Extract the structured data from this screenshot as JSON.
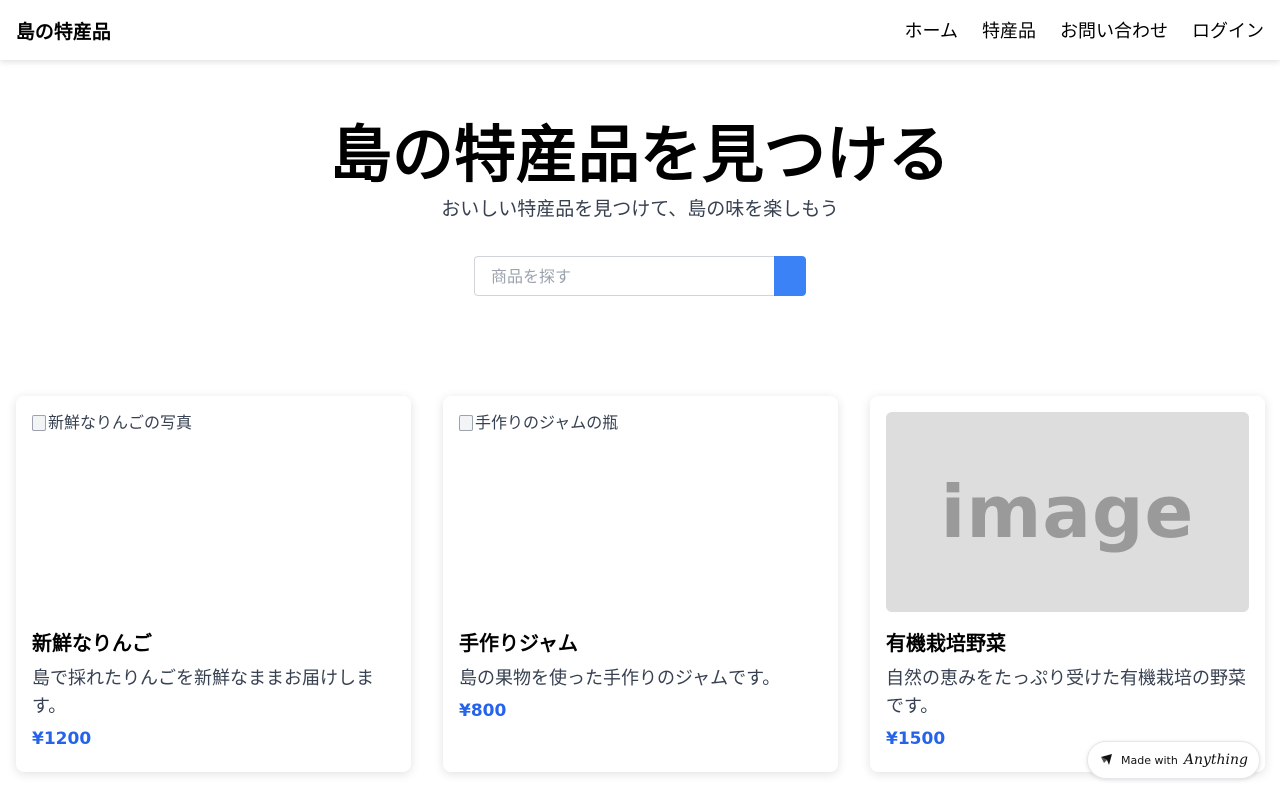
{
  "navbar": {
    "brand": "島の特産品",
    "links": [
      {
        "label": "ホーム"
      },
      {
        "label": "特産品"
      },
      {
        "label": "お問い合わせ"
      },
      {
        "label": "ログイン"
      }
    ]
  },
  "hero": {
    "title": "島の特産品を見つける",
    "subtitle": "おいしい特産品を見つけて、島の味を楽しもう",
    "search": {
      "placeholder": "商品を探す",
      "value": ""
    }
  },
  "products": [
    {
      "image_alt": "新鮮なりんごの写真",
      "title": "新鮮なりんご",
      "description": "島で採れたりんごを新鮮なままお届けします。",
      "price": "¥1200"
    },
    {
      "image_alt": "手作りのジャムの瓶",
      "title": "手作りジャム",
      "description": "島の果物を使った手作りのジャムです。",
      "price": "¥800"
    },
    {
      "image_placeholder_text": "image",
      "title": "有機栽培野菜",
      "description": "自然の恵みをたっぷり受けた有機栽培の野菜です。",
      "price": "¥1500"
    }
  ],
  "badge": {
    "prefix": "Made with",
    "brand": "Anything"
  },
  "colors": {
    "accent": "#3b82f6",
    "price": "#2563eb",
    "placeholder_bg": "#dddddd",
    "placeholder_text": "#9a9a9a"
  }
}
